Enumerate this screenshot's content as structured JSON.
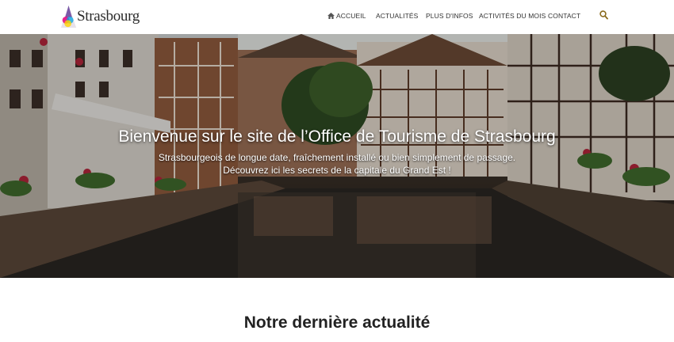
{
  "header": {
    "logo_text": "Strasbourg",
    "nav": [
      {
        "label": "ACCUEIL",
        "icon": "home-icon",
        "active": true
      },
      {
        "label": "ACTUALITÉS"
      },
      {
        "label": "PLUS D'INFOS"
      },
      {
        "label": "ACTIVITÉS DU MOIS"
      },
      {
        "label": "CONTACT"
      }
    ],
    "search_icon": "search-icon"
  },
  "hero": {
    "title": "Bienvenue sur le site de l’Office de Tourisme de Strasbourg",
    "subtitle_line1": "Strasbourgeois de longue date, fraîchement installé ou bien simplement de passage.",
    "subtitle_line2": "Découvrez ici les secrets de la capitale du Grand Est !"
  },
  "section": {
    "title": "Notre dernière actualité"
  },
  "colors": {
    "nav_text": "#333333",
    "hero_text": "#ffffff",
    "section_title": "#222222"
  }
}
